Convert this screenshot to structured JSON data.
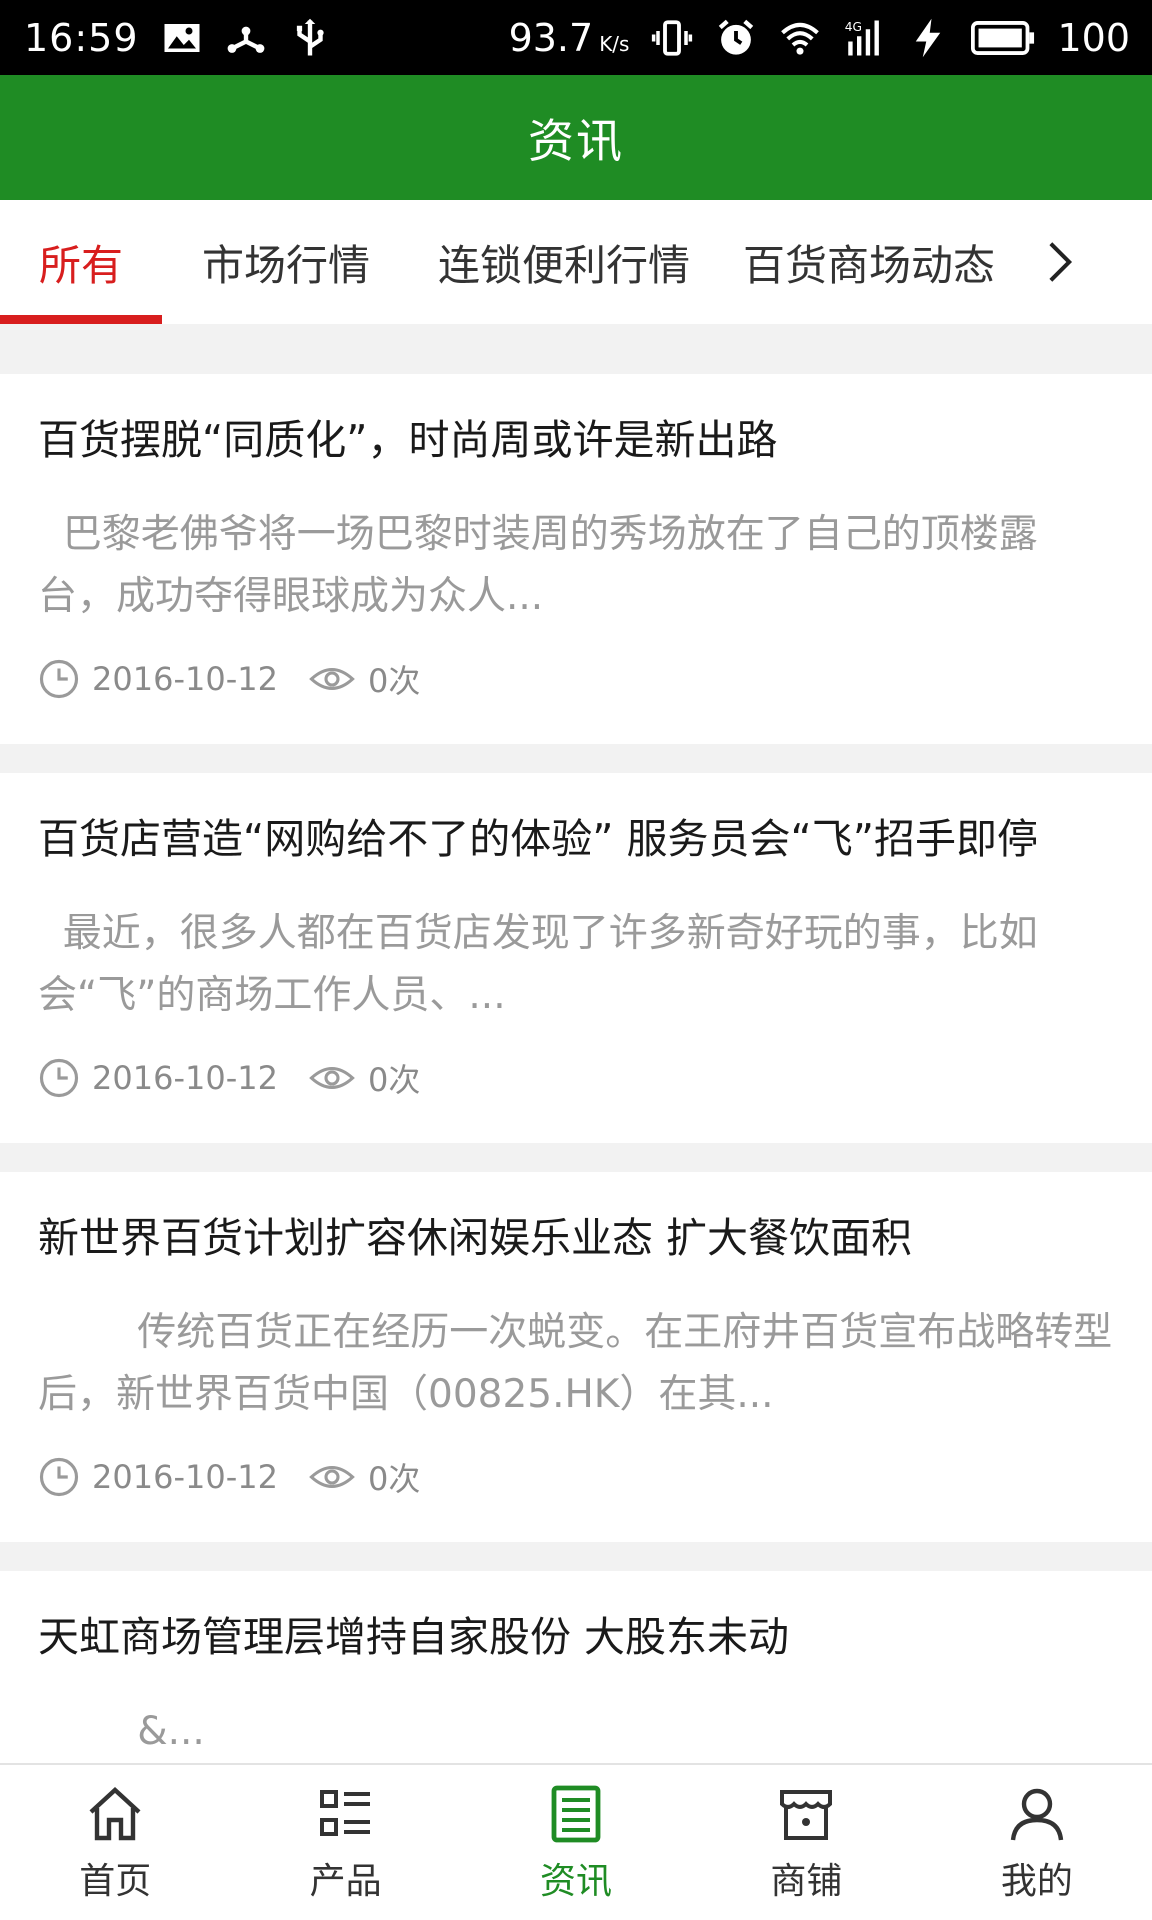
{
  "status_bar": {
    "time": "16:59",
    "speed": "93.7",
    "speed_unit": "K/s",
    "network": "4G",
    "battery": "100"
  },
  "header": {
    "title": "资讯"
  },
  "tabs": [
    {
      "label": "所有",
      "active": true
    },
    {
      "label": "市场行情",
      "active": false
    },
    {
      "label": "连锁便利行情",
      "active": false
    },
    {
      "label": "百货商场动态",
      "active": false
    }
  ],
  "articles": [
    {
      "title": "百货摆脱“同质化”，时尚周或许是新出路",
      "summary": "  巴黎老佛爷将一场巴黎时装周的秀场放在了自己的顶楼露台，成功夺得眼球成为众人...",
      "date": "2016-10-12",
      "views": "0次"
    },
    {
      "title": "百货店营造“网购给不了的体验” 服务员会“飞”招手即停",
      "summary": "  最近，很多人都在百货店发现了许多新奇好玩的事，比如会“飞”的商场工作人员、...",
      "date": "2016-10-12",
      "views": "0次"
    },
    {
      "title": "新世界百货计划扩容休闲娱乐业态 扩大餐饮面积",
      "summary": "        传统百货正在经历一次蜕变。在王府井百货宣布战略转型后，新世界百货中国（00825.HK）在其...",
      "date": "2016-10-12",
      "views": "0次"
    },
    {
      "title": "天虹商场管理层增持自家股份 大股东未动",
      "summary": "        &...",
      "date": "",
      "views": ""
    }
  ],
  "bottom_nav": [
    {
      "label": "首页",
      "icon": "home-icon",
      "active": false
    },
    {
      "label": "产品",
      "icon": "list-icon",
      "active": false
    },
    {
      "label": "资讯",
      "icon": "news-icon",
      "active": true
    },
    {
      "label": "商铺",
      "icon": "shop-icon",
      "active": false
    },
    {
      "label": "我的",
      "icon": "user-icon",
      "active": false
    }
  ],
  "colors": {
    "header_green": "#1f8c24",
    "tab_active_red": "#d81e1e",
    "nav_active_green": "#1f8c24"
  }
}
